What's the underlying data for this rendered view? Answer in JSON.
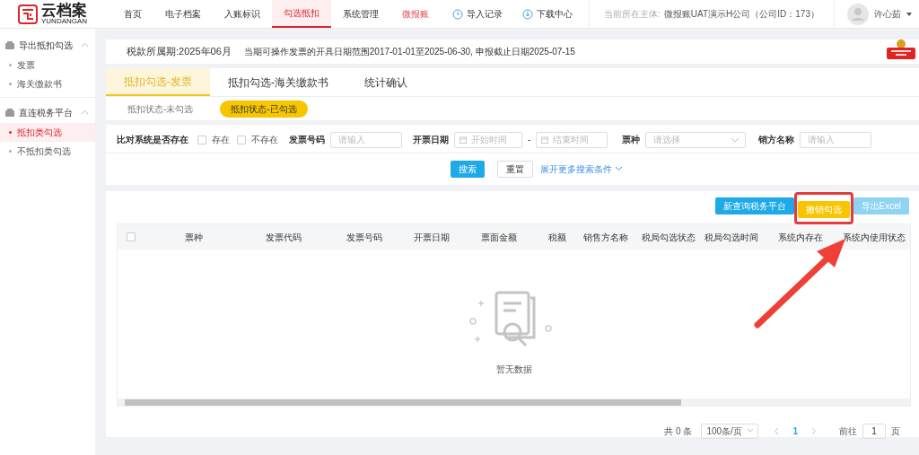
{
  "header": {
    "logo": {
      "text": "云档案",
      "sub": "YUNDANGAN"
    },
    "nav": [
      {
        "label": "首页",
        "selected": false,
        "kind": "normal"
      },
      {
        "label": "电子档案",
        "selected": false,
        "kind": "normal"
      },
      {
        "label": "入账标识",
        "selected": false,
        "kind": "normal"
      },
      {
        "label": "勾选抵扣",
        "selected": true,
        "kind": "normal"
      },
      {
        "label": "系统管理",
        "selected": false,
        "kind": "normal"
      },
      {
        "label": "微报账",
        "selected": false,
        "kind": "special"
      }
    ],
    "actions": [
      {
        "label": "导入记录",
        "kind": "history"
      },
      {
        "label": "下载中心",
        "kind": "download"
      }
    ],
    "entity_label": "当前所在主体:",
    "entity_name": "微报账UAT演示H公司（公司ID：173）",
    "user": "许心茹"
  },
  "sidebar": [
    {
      "title": "导出抵扣勾选",
      "expanded": true,
      "items": [
        {
          "label": "发票",
          "selected": false
        },
        {
          "label": "海关缴款书",
          "selected": false
        }
      ]
    },
    {
      "title": "直连税务平台",
      "expanded": true,
      "items": [
        {
          "label": "抵扣类勾选",
          "selected": true
        },
        {
          "label": "不抵扣类勾选",
          "selected": false
        }
      ]
    }
  ],
  "period": {
    "label": "税款所属期:",
    "value": "2025年06月",
    "notice": "当期可操作发票的开具日期范围2017-01-01至2025-06-30, 申报截止日期2025-07-15"
  },
  "tabs": [
    {
      "label": "抵扣勾选-发票",
      "selected": true
    },
    {
      "label": "抵扣勾选-海关缴款书",
      "selected": false
    },
    {
      "label": "统计确认",
      "selected": false
    }
  ],
  "subtabs": [
    {
      "label": "抵扣状态-未勾选",
      "selected": false
    },
    {
      "label": "抵扣状态-已勾选",
      "selected": true
    }
  ],
  "filters": {
    "compare_label": "比对系统是否存在",
    "checkboxes": [
      {
        "label": "存在",
        "checked": false
      },
      {
        "label": "不存在",
        "checked": false
      }
    ],
    "invoice_no": {
      "label": "发票号码",
      "placeholder": "请输入"
    },
    "date": {
      "label": "开票日期",
      "start_placeholder": "开始时间",
      "separator": "-",
      "end_placeholder": "结束时间"
    },
    "type": {
      "label": "票种",
      "placeholder": "请选择"
    },
    "seller": {
      "label": "销方名称",
      "placeholder": "请输入"
    },
    "search": "搜索",
    "reset": "重置",
    "expand": "展开更多搜索条件"
  },
  "toolbar": [
    {
      "label": "新查询税务平台",
      "kind": "primary",
      "disabled": false,
      "annotated": false
    },
    {
      "label": "撤销勾选",
      "kind": "warning",
      "disabled": false,
      "annotated": true
    },
    {
      "label": "导出Excel",
      "kind": "primary",
      "disabled": true,
      "annotated": false
    }
  ],
  "table": {
    "select_all": {
      "checked": false
    },
    "columns": [
      "票种",
      "发票代码",
      "发票号码",
      "开票日期",
      "票面金额",
      "税额",
      "销售方名称",
      "税局勾选状态",
      "税局勾选时间",
      "系统内存在",
      "系统内使用状态"
    ],
    "empty": "暂无数据"
  },
  "pagination": {
    "total": "共 0 条",
    "page_size": "100条/页",
    "page": "1",
    "goto_label": "前往",
    "goto_value": "1",
    "goto_suffix": "页"
  }
}
